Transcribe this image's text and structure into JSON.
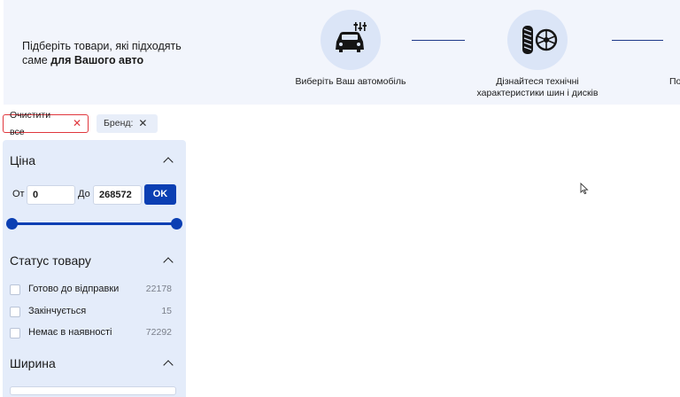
{
  "banner": {
    "intro_line1": "Підберіть товари, які підходять",
    "intro_line2_prefix": "саме ",
    "intro_line2_bold": "для Вашого авто",
    "steps": [
      {
        "icon": "car-settings-icon",
        "label": "Виберіть Ваш автомобіль"
      },
      {
        "icon": "tire-wheel-icon",
        "label_line1": "Дізнайтеся технічні",
        "label_line2": "характеристики шин і дисків"
      },
      {
        "label_partial": "По"
      }
    ]
  },
  "chips": {
    "clear_all": "Очистити все",
    "brand": "Бренд:"
  },
  "filters": {
    "price": {
      "title": "Ціна",
      "from_label": "От",
      "from_value": "0",
      "to_label": "До",
      "to_value": "268572",
      "ok_label": "OK"
    },
    "status": {
      "title": "Статус товару",
      "items": [
        {
          "label": "Готово до відправки",
          "count": "22178"
        },
        {
          "label": "Закінчується",
          "count": "15"
        },
        {
          "label": "Немає в наявності",
          "count": "72292"
        }
      ]
    },
    "width": {
      "title": "Ширина"
    }
  },
  "colors": {
    "accent": "#0b3fb3",
    "banner_bg": "#f2f5fc",
    "sidebar_bg": "#e4ecfa",
    "danger": "#e0373d"
  }
}
